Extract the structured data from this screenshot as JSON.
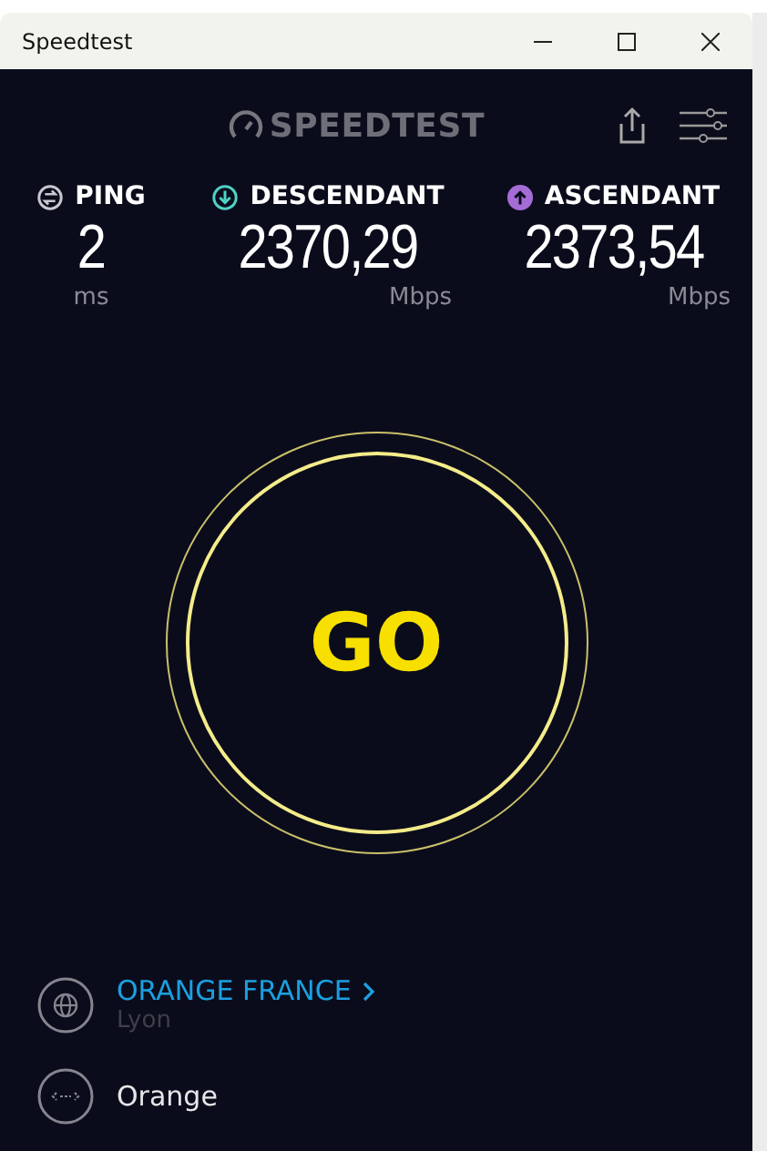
{
  "window": {
    "title": "Speedtest"
  },
  "logo": "SPEEDTEST",
  "metrics": [
    {
      "kind": "ping",
      "label": "PING",
      "value": "2",
      "unit": "ms",
      "color": "#c8c8d0"
    },
    {
      "kind": "download",
      "label": "DESCENDANT",
      "value": "2370,29",
      "unit": "Mbps",
      "color": "#4fd1c5"
    },
    {
      "kind": "upload",
      "label": "ASCENDANT",
      "value": "2373,54",
      "unit": "Mbps",
      "color": "#a56bd6"
    }
  ],
  "go_button": "GO",
  "connection": [
    {
      "kind": "server",
      "name": "ORANGE FRANCE",
      "location": "Lyon"
    },
    {
      "kind": "isp",
      "name": "Orange"
    }
  ]
}
